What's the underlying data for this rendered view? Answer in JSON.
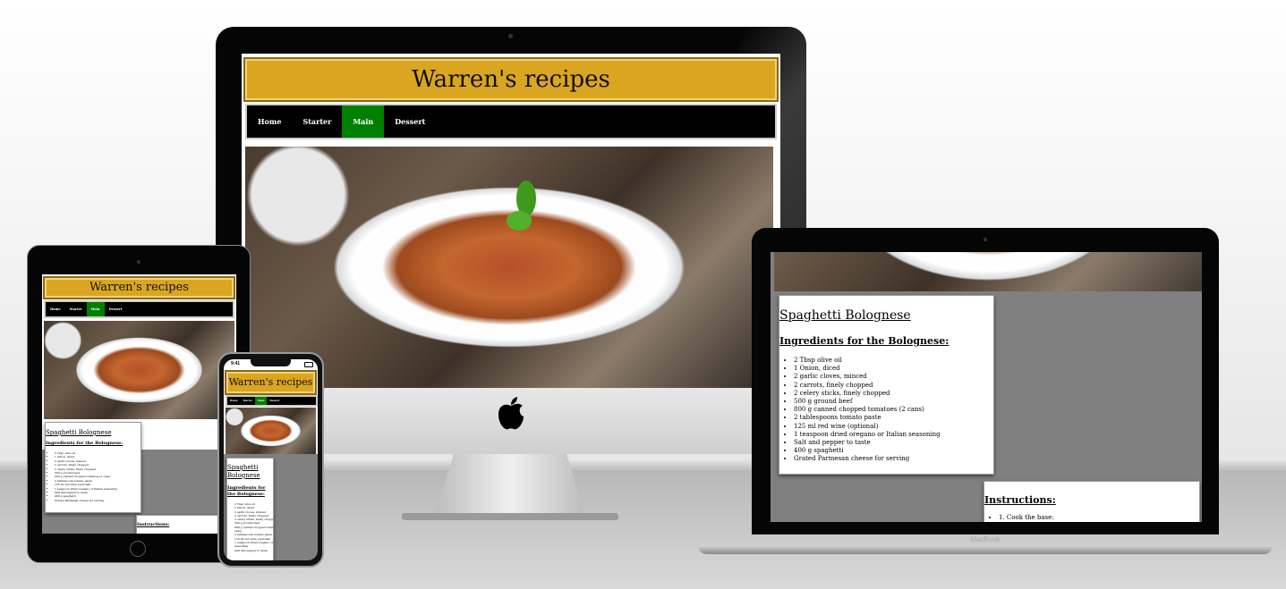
{
  "site": {
    "title": "Warren's recipes",
    "nav": [
      "Home",
      "Starter",
      "Main",
      "Dessert"
    ],
    "active_nav": "Main"
  },
  "recipe": {
    "title": "Spaghetti Bolognese",
    "ingredients_heading": "Ingredients for the Bolognese:",
    "ingredients": [
      "2 Tbsp olive oil",
      "1 Onion, diced",
      "2 garlic cloves, minced",
      "2 carrots, finely chopped",
      "2 celery sticks, finely chopped",
      "500 g ground beef",
      "800 g canned chopped tomatoes (2 cans)",
      "2 tablespoons tomato paste",
      "125 ml red wine (optional)",
      "1 teaspoon dried oregano or Italian seasoning",
      "Salt and pepper to taste",
      "400 g spaghetti",
      "Grated Parmesan cheese for serving"
    ],
    "instructions_heading": "Instructions:",
    "instructions_first": "1. Cook the base:"
  },
  "devices": {
    "laptop_label": "MacBook",
    "phone_time": "9:41"
  },
  "colors": {
    "header_gold": "#daa520",
    "nav_active": "#008000",
    "page_grey": "#808080"
  }
}
